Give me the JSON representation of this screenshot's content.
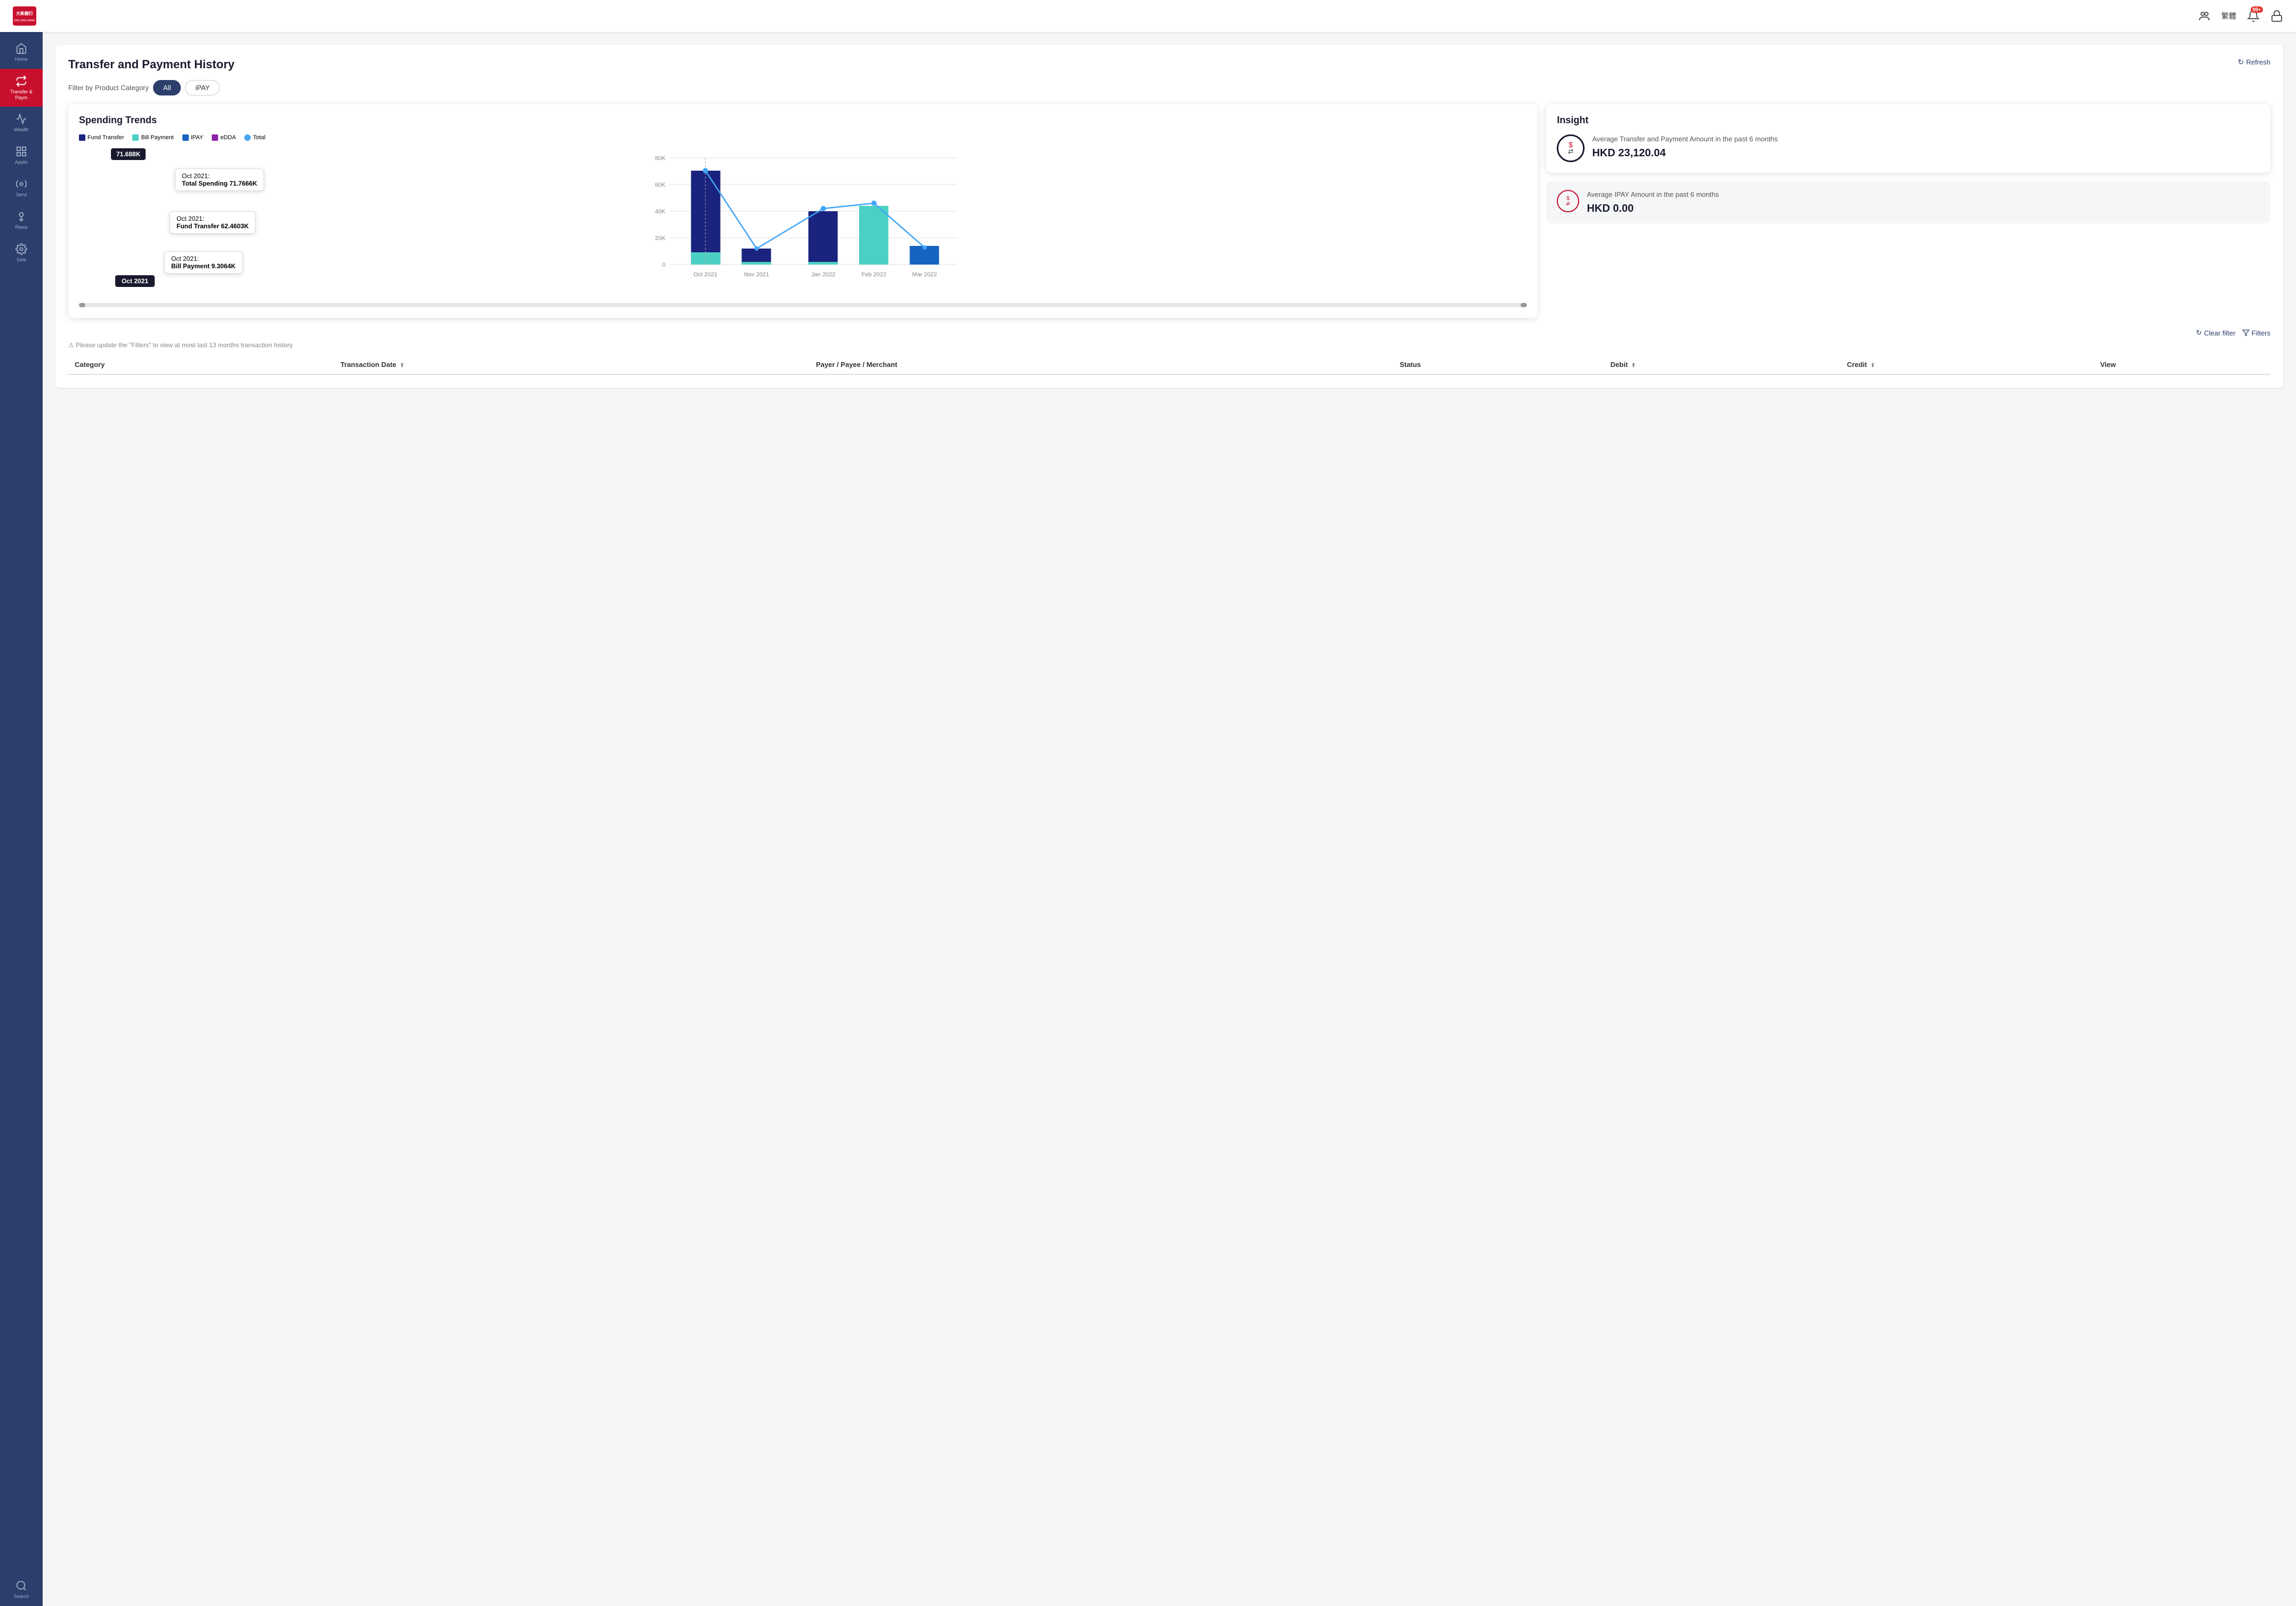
{
  "app": {
    "title": "Dah Sing Bank",
    "lang_btn": "繁體",
    "notification_count": "99+"
  },
  "sidebar": {
    "items": [
      {
        "id": "home",
        "label": "Home",
        "active": false
      },
      {
        "id": "transfer-payment",
        "label": "Transfer & Payment",
        "active": true
      },
      {
        "id": "wealth",
        "label": "Wealth",
        "active": false
      },
      {
        "id": "applications",
        "label": "Applications",
        "active": false
      },
      {
        "id": "services",
        "label": "Services",
        "active": false
      },
      {
        "id": "rewards",
        "label": "Rewards",
        "active": false
      },
      {
        "id": "settings",
        "label": "Settings",
        "active": false
      },
      {
        "id": "search",
        "label": "Search",
        "active": false
      }
    ]
  },
  "page": {
    "title": "Transfer and Payment History",
    "refresh_btn": "Refresh",
    "filter_label": "Filter by Product Category",
    "filter_all": "All",
    "filter_ipay": "iPAY",
    "notice": "Please update the \"Filters\" to view at most last 13 months transaction history",
    "clear_filter": "Clear filter",
    "filters": "Filters"
  },
  "chart": {
    "title": "Spending Trends",
    "legend": [
      {
        "label": "Fund Transfer",
        "color": "#1a237e"
      },
      {
        "label": "Bill Payment",
        "color": "#4dd0c4"
      },
      {
        "label": "IPAY",
        "color": "#1565c0"
      },
      {
        "label": "eDDA",
        "color": "#8e24aa"
      },
      {
        "label": "Total",
        "color": "#42a5f5"
      }
    ],
    "y_labels": [
      "80K",
      "60K",
      "40K",
      "20K",
      "0"
    ],
    "x_labels": [
      "Oct 2021",
      "Nov 2021",
      "Jan 2022",
      "Feb 2022",
      "Mar 2022"
    ],
    "total_label": "71.688K",
    "tooltips": {
      "total": {
        "month": "Oct 2021:",
        "label": "Total Spending 71.7666K"
      },
      "fund": {
        "month": "Oct 2021:",
        "label": "Fund Transfer 62.4603K"
      },
      "bill": {
        "month": "Oct 2021:",
        "label": "Bill Payment 9.3064K"
      }
    },
    "oct_label": "Oct 2021"
  },
  "insight": {
    "title": "Insight",
    "transfer_desc": "Average Transfer and Payment Amount in the past 6 months",
    "transfer_amount": "HKD 23,120.04",
    "ipay_desc": "Average IPAY Amount in the past 6 months",
    "ipay_amount": "HKD 0.00"
  },
  "table": {
    "columns": [
      {
        "id": "category",
        "label": "Category",
        "sortable": false
      },
      {
        "id": "transaction_date",
        "label": "Transaction Date",
        "sortable": true
      },
      {
        "id": "payer",
        "label": "Payer / Payee / Merchant",
        "sortable": false
      },
      {
        "id": "status",
        "label": "Status",
        "sortable": false
      },
      {
        "id": "debit",
        "label": "Debit",
        "sortable": true
      },
      {
        "id": "credit",
        "label": "Credit",
        "sortable": true
      },
      {
        "id": "view",
        "label": "View",
        "sortable": false
      }
    ],
    "rows": []
  }
}
